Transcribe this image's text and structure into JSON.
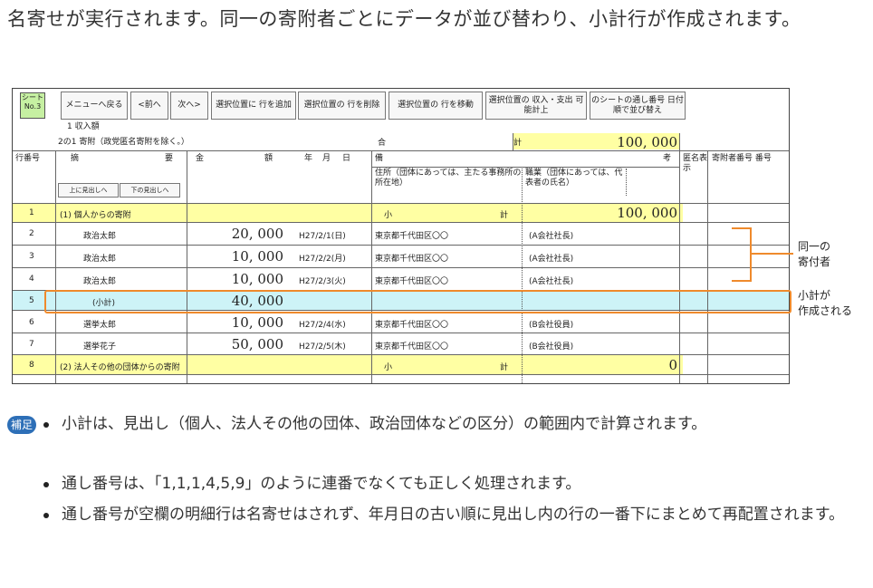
{
  "intro": "名寄せが実行されます。同一の寄附者ごとにデータが並び替わり、小計行が作成されます。",
  "sheet_no": "シート No.3",
  "toolbar": [
    "メニューへ戻る",
    "<前へ",
    "次へ>",
    "選択位置に 行を追加",
    "選択位置の 行を削除",
    "選択位置の 行を移動",
    "選択位置の 収入・支出 可能計上",
    "のシートの通し番号 日付順で並び替え"
  ],
  "section_label": "1 収入額",
  "section_sub": "2の1 寄附（政党匿名寄附を除く。）",
  "total_mid": "合",
  "total_right": "計",
  "total_amount": "100, 000",
  "headers": {
    "row_no": "行番号",
    "summary": "摘",
    "summary2": "要",
    "up": "上に見出しへ",
    "down": "下の見出しへ",
    "amount": "金",
    "amount2": "額",
    "date": "年",
    "date2": "月",
    "date3": "日",
    "remarks": "備",
    "address": "住所（団体にあっては、主たる事務所の所在地）",
    "occupation": "職業（団体にあっては、代表者の氏名）",
    "remarks2": "考",
    "anon": "匿名表示",
    "serial": "寄附者番号 番号"
  },
  "rows": [
    {
      "no": "1",
      "name": "(1) 個人からの寄附",
      "amount": "100, 000",
      "date": "",
      "address": "小",
      "occ": "計",
      "type": "heading"
    },
    {
      "no": "2",
      "name": "政治太郎",
      "amount": "20, 000",
      "date": "H27/2/1(日)",
      "address": "東京都千代田区〇〇",
      "occ": "(A会社社長)",
      "type": "data"
    },
    {
      "no": "3",
      "name": "政治太郎",
      "amount": "10, 000",
      "date": "H27/2/2(月)",
      "address": "東京都千代田区〇〇",
      "occ": "(A会社社長)",
      "type": "data"
    },
    {
      "no": "4",
      "name": "政治太郎",
      "amount": "10, 000",
      "date": "H27/2/3(火)",
      "address": "東京都千代田区〇〇",
      "occ": "(A会社社長)",
      "type": "data"
    },
    {
      "no": "5",
      "name": "(小計)",
      "amount": "40, 000",
      "date": "",
      "address": "",
      "occ": "",
      "type": "subtotal"
    },
    {
      "no": "6",
      "name": "選挙太郎",
      "amount": "10, 000",
      "date": "H27/2/4(水)",
      "address": "東京都千代田区〇〇",
      "occ": "(B会社役員)",
      "type": "data"
    },
    {
      "no": "7",
      "name": "選挙花子",
      "amount": "50, 000",
      "date": "H27/2/5(木)",
      "address": "東京都千代田区〇〇",
      "occ": "(B会社役員)",
      "type": "data"
    },
    {
      "no": "8",
      "name": "(2) 法人その他の団体からの寄附",
      "amount": "0",
      "date": "",
      "address": "小",
      "occ": "計",
      "type": "heading"
    }
  ],
  "annotations": {
    "same_donor_1": "同一の",
    "same_donor_2": "寄付者",
    "subtotal_1": "小計が",
    "subtotal_2": "作成される"
  },
  "notes_badge": "補足",
  "notes": [
    "小計は、見出し（個人、法人その他の団体、政治団体などの区分）の範囲内で計算されます。",
    "通し番号は、「1,1,1,4,5,9」のように連番でなくても正しく処理されます。",
    "通し番号が空欄の明細行は名寄せはされず、年月日の古い順に見出し内の行の一番下にまとめて再配置されます。"
  ],
  "colors": {
    "accent": "#ef8a2c",
    "highlight": "#ffffa3",
    "subtotal": "#cdf3f7",
    "badge": "#2d6fb7",
    "sheet_tab": "#c6f0a2"
  }
}
